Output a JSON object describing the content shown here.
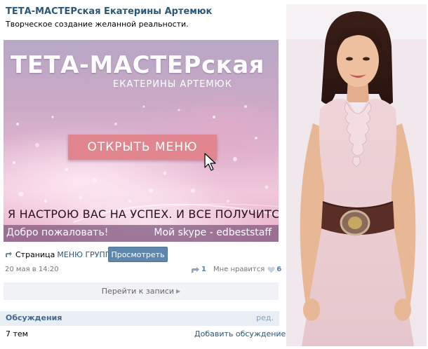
{
  "group": {
    "name": "ТЕТА-МАСТЕРская Екатерины Артемюк",
    "status": "Творческое создание желанной реальности."
  },
  "banner": {
    "title": "ТЕТА-МАСТЕРская",
    "subtitle": "ЕКАТЕРИНЫ АРТЕМЮК",
    "menu_button": "ОТКРЫТЬ МЕНЮ",
    "slogan": "Я НАСТРОЮ ВАС НА УСПЕХ. И ВСЕ ПОЛУЧИТСЯ!",
    "welcome": "Добро пожаловать!",
    "skype": "Мой skype - edbeststaff"
  },
  "post": {
    "page_prefix": "Страница",
    "page_link": "МЕНЮ ГРУППЫ",
    "view_button": "Просмотреть",
    "date": "20 мая в 14:20",
    "reposts": "1",
    "likes_label": "Мне нравится",
    "likes": "6",
    "goto_post": "Перейти к записи"
  },
  "discussions": {
    "title": "Обсуждения",
    "edit": "ред.",
    "count": "7 тем",
    "add": "Добавить обсуждение"
  },
  "colors": {
    "link": "#2b587a",
    "button": "#5f87ad",
    "menu_button": "#e1868f",
    "header_bg": "#e8eef4"
  },
  "icons": [
    "share-icon",
    "cursor-icon",
    "repost-icon",
    "heart-icon",
    "chevron-right-icon"
  ]
}
